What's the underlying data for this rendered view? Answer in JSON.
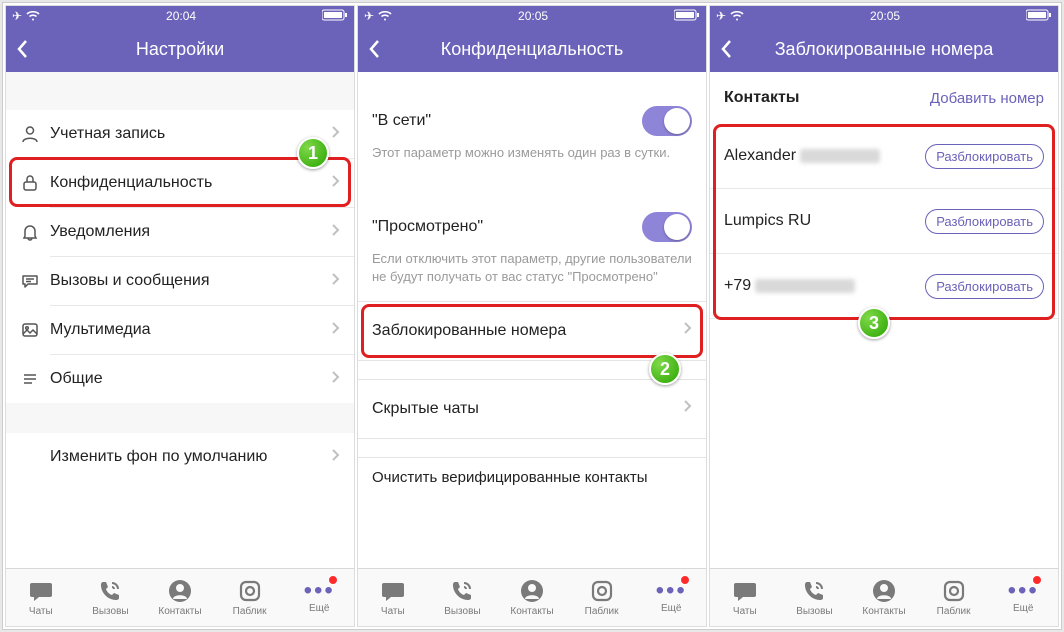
{
  "screen1": {
    "time": "20:04",
    "title": "Настройки",
    "rows": {
      "account": "Учетная запись",
      "privacy": "Конфиденциальность",
      "notifications": "Уведомления",
      "calls_msgs": "Вызовы и сообщения",
      "multimedia": "Мультимедиа",
      "general": "Общие",
      "wallpaper": "Изменить фон по умолчанию"
    },
    "badge": "1"
  },
  "screen2": {
    "time": "20:05",
    "title": "Конфиденциальность",
    "online_label": "\"В сети\"",
    "online_desc": "Этот параметр можно изменять один раз в сутки.",
    "seen_label": "\"Просмотрено\"",
    "seen_desc": "Если отключить этот параметр, другие пользователи не будут получать от вас статус \"Просмотрено\"",
    "blocked": "Заблокированные номера",
    "hidden": "Скрытые чаты",
    "clear": "Очистить верифицированные контакты",
    "badge": "2"
  },
  "screen3": {
    "time": "20:05",
    "title": "Заблокированные номера",
    "contacts_label": "Контакты",
    "add_label": "Добавить номер",
    "unblock": "Разблокировать",
    "entries": {
      "e1": "Alexander",
      "e2": "Lumpics RU",
      "e3": "+79"
    },
    "badge": "3"
  },
  "tabs": {
    "chats": "Чаты",
    "calls": "Вызовы",
    "contacts": "Контакты",
    "public": "Паблик",
    "more": "Ещё"
  }
}
